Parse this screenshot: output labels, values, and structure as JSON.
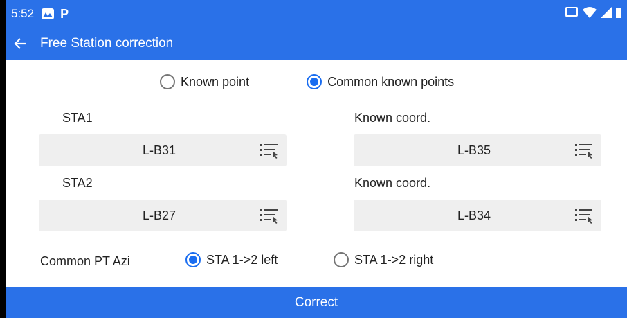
{
  "status_bar": {
    "time": "5:52",
    "app_icons": [
      "photos-icon",
      "p-icon"
    ],
    "p_glyph": "P",
    "system_icons": [
      "cast-icon",
      "wifi-icon",
      "signal-icon",
      "battery-icon"
    ]
  },
  "app_bar": {
    "title": "Free Station correction",
    "back_icon": "arrow-left-icon"
  },
  "mode": {
    "options": [
      {
        "label": "Known point",
        "checked": false
      },
      {
        "label": "Common known points",
        "checked": true
      }
    ]
  },
  "form": {
    "sta1_label": "STA1",
    "sta1_value": "L-B31",
    "known1_label": "Known coord.",
    "known1_value": "L-B35",
    "sta2_label": "STA2",
    "sta2_value": "L-B27",
    "known2_label": "Known coord.",
    "known2_value": "L-B34",
    "azi_label": "Common PT Azi",
    "azi_options": [
      {
        "label": "STA 1->2 left",
        "checked": true
      },
      {
        "label": "STA 1->2 right",
        "checked": false
      }
    ]
  },
  "actions": {
    "correct_label": "Correct"
  },
  "colors": {
    "primary": "#2a71e8",
    "radio_checked": "#1a6df0",
    "field_bg": "#efefef"
  }
}
